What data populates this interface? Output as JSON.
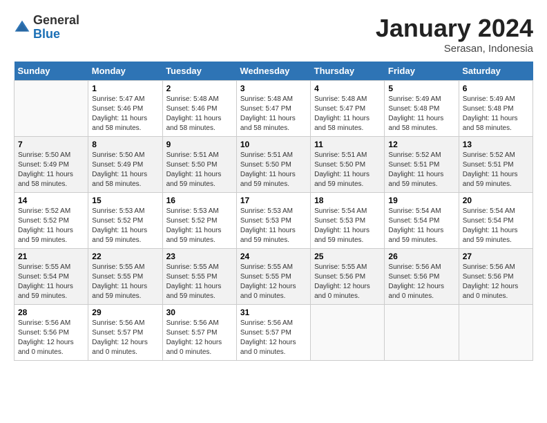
{
  "header": {
    "logo_general": "General",
    "logo_blue": "Blue",
    "month_title": "January 2024",
    "subtitle": "Serasan, Indonesia"
  },
  "days_of_week": [
    "Sunday",
    "Monday",
    "Tuesday",
    "Wednesday",
    "Thursday",
    "Friday",
    "Saturday"
  ],
  "weeks": [
    [
      {
        "day": "",
        "sunrise": "",
        "sunset": "",
        "daylight": ""
      },
      {
        "day": "1",
        "sunrise": "Sunrise: 5:47 AM",
        "sunset": "Sunset: 5:46 PM",
        "daylight": "Daylight: 11 hours and 58 minutes."
      },
      {
        "day": "2",
        "sunrise": "Sunrise: 5:48 AM",
        "sunset": "Sunset: 5:46 PM",
        "daylight": "Daylight: 11 hours and 58 minutes."
      },
      {
        "day": "3",
        "sunrise": "Sunrise: 5:48 AM",
        "sunset": "Sunset: 5:47 PM",
        "daylight": "Daylight: 11 hours and 58 minutes."
      },
      {
        "day": "4",
        "sunrise": "Sunrise: 5:48 AM",
        "sunset": "Sunset: 5:47 PM",
        "daylight": "Daylight: 11 hours and 58 minutes."
      },
      {
        "day": "5",
        "sunrise": "Sunrise: 5:49 AM",
        "sunset": "Sunset: 5:48 PM",
        "daylight": "Daylight: 11 hours and 58 minutes."
      },
      {
        "day": "6",
        "sunrise": "Sunrise: 5:49 AM",
        "sunset": "Sunset: 5:48 PM",
        "daylight": "Daylight: 11 hours and 58 minutes."
      }
    ],
    [
      {
        "day": "7",
        "sunrise": "Sunrise: 5:50 AM",
        "sunset": "Sunset: 5:49 PM",
        "daylight": "Daylight: 11 hours and 58 minutes."
      },
      {
        "day": "8",
        "sunrise": "Sunrise: 5:50 AM",
        "sunset": "Sunset: 5:49 PM",
        "daylight": "Daylight: 11 hours and 58 minutes."
      },
      {
        "day": "9",
        "sunrise": "Sunrise: 5:51 AM",
        "sunset": "Sunset: 5:50 PM",
        "daylight": "Daylight: 11 hours and 59 minutes."
      },
      {
        "day": "10",
        "sunrise": "Sunrise: 5:51 AM",
        "sunset": "Sunset: 5:50 PM",
        "daylight": "Daylight: 11 hours and 59 minutes."
      },
      {
        "day": "11",
        "sunrise": "Sunrise: 5:51 AM",
        "sunset": "Sunset: 5:50 PM",
        "daylight": "Daylight: 11 hours and 59 minutes."
      },
      {
        "day": "12",
        "sunrise": "Sunrise: 5:52 AM",
        "sunset": "Sunset: 5:51 PM",
        "daylight": "Daylight: 11 hours and 59 minutes."
      },
      {
        "day": "13",
        "sunrise": "Sunrise: 5:52 AM",
        "sunset": "Sunset: 5:51 PM",
        "daylight": "Daylight: 11 hours and 59 minutes."
      }
    ],
    [
      {
        "day": "14",
        "sunrise": "Sunrise: 5:52 AM",
        "sunset": "Sunset: 5:52 PM",
        "daylight": "Daylight: 11 hours and 59 minutes."
      },
      {
        "day": "15",
        "sunrise": "Sunrise: 5:53 AM",
        "sunset": "Sunset: 5:52 PM",
        "daylight": "Daylight: 11 hours and 59 minutes."
      },
      {
        "day": "16",
        "sunrise": "Sunrise: 5:53 AM",
        "sunset": "Sunset: 5:52 PM",
        "daylight": "Daylight: 11 hours and 59 minutes."
      },
      {
        "day": "17",
        "sunrise": "Sunrise: 5:53 AM",
        "sunset": "Sunset: 5:53 PM",
        "daylight": "Daylight: 11 hours and 59 minutes."
      },
      {
        "day": "18",
        "sunrise": "Sunrise: 5:54 AM",
        "sunset": "Sunset: 5:53 PM",
        "daylight": "Daylight: 11 hours and 59 minutes."
      },
      {
        "day": "19",
        "sunrise": "Sunrise: 5:54 AM",
        "sunset": "Sunset: 5:54 PM",
        "daylight": "Daylight: 11 hours and 59 minutes."
      },
      {
        "day": "20",
        "sunrise": "Sunrise: 5:54 AM",
        "sunset": "Sunset: 5:54 PM",
        "daylight": "Daylight: 11 hours and 59 minutes."
      }
    ],
    [
      {
        "day": "21",
        "sunrise": "Sunrise: 5:55 AM",
        "sunset": "Sunset: 5:54 PM",
        "daylight": "Daylight: 11 hours and 59 minutes."
      },
      {
        "day": "22",
        "sunrise": "Sunrise: 5:55 AM",
        "sunset": "Sunset: 5:55 PM",
        "daylight": "Daylight: 11 hours and 59 minutes."
      },
      {
        "day": "23",
        "sunrise": "Sunrise: 5:55 AM",
        "sunset": "Sunset: 5:55 PM",
        "daylight": "Daylight: 11 hours and 59 minutes."
      },
      {
        "day": "24",
        "sunrise": "Sunrise: 5:55 AM",
        "sunset": "Sunset: 5:55 PM",
        "daylight": "Daylight: 12 hours and 0 minutes."
      },
      {
        "day": "25",
        "sunrise": "Sunrise: 5:55 AM",
        "sunset": "Sunset: 5:56 PM",
        "daylight": "Daylight: 12 hours and 0 minutes."
      },
      {
        "day": "26",
        "sunrise": "Sunrise: 5:56 AM",
        "sunset": "Sunset: 5:56 PM",
        "daylight": "Daylight: 12 hours and 0 minutes."
      },
      {
        "day": "27",
        "sunrise": "Sunrise: 5:56 AM",
        "sunset": "Sunset: 5:56 PM",
        "daylight": "Daylight: 12 hours and 0 minutes."
      }
    ],
    [
      {
        "day": "28",
        "sunrise": "Sunrise: 5:56 AM",
        "sunset": "Sunset: 5:56 PM",
        "daylight": "Daylight: 12 hours and 0 minutes."
      },
      {
        "day": "29",
        "sunrise": "Sunrise: 5:56 AM",
        "sunset": "Sunset: 5:57 PM",
        "daylight": "Daylight: 12 hours and 0 minutes."
      },
      {
        "day": "30",
        "sunrise": "Sunrise: 5:56 AM",
        "sunset": "Sunset: 5:57 PM",
        "daylight": "Daylight: 12 hours and 0 minutes."
      },
      {
        "day": "31",
        "sunrise": "Sunrise: 5:56 AM",
        "sunset": "Sunset: 5:57 PM",
        "daylight": "Daylight: 12 hours and 0 minutes."
      },
      {
        "day": "",
        "sunrise": "",
        "sunset": "",
        "daylight": ""
      },
      {
        "day": "",
        "sunrise": "",
        "sunset": "",
        "daylight": ""
      },
      {
        "day": "",
        "sunrise": "",
        "sunset": "",
        "daylight": ""
      }
    ]
  ]
}
